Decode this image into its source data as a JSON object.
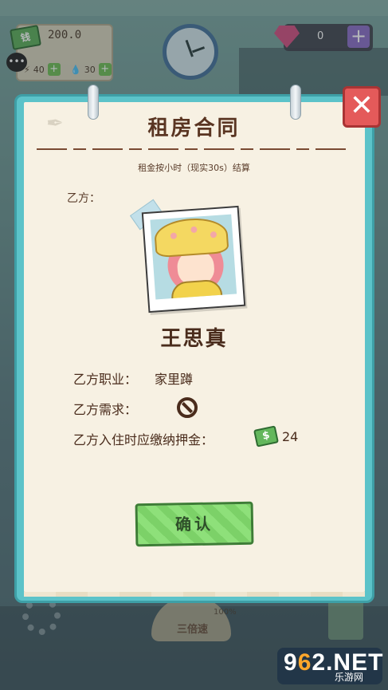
{
  "hud": {
    "money_icon_label": "钱",
    "money": "200.0",
    "stat_energy": "40",
    "stat_water": "30",
    "stat_plus": "+",
    "gems": "0",
    "gems_plus": "+",
    "chat_icon": "chat-bubble-icon"
  },
  "bottom_hud": {
    "speed_label": "三倍速",
    "speed_percent": "100%"
  },
  "watermark": {
    "brand_9": "9",
    "brand_6": "6",
    "brand_2": "2",
    "brand_net": ".NET",
    "sub": "乐游网"
  },
  "contract": {
    "title": "租房合同",
    "subtitle": "租金按小时（现实30s）结算",
    "party_label": "乙方：",
    "tenant_name": "王思真",
    "job_label": "乙方职业：",
    "job_value": "家里蹲",
    "need_label": "乙方需求：",
    "deposit_label": "乙方入住时应缴纳押金：",
    "deposit_value": "24",
    "confirm_label": "确认",
    "close_label": "✕"
  },
  "colors": {
    "panel_teal": "#5cc3c9",
    "paper": "#f7f1e3",
    "confirm_green": "#8ee07a",
    "close_red": "#e45a5a"
  }
}
